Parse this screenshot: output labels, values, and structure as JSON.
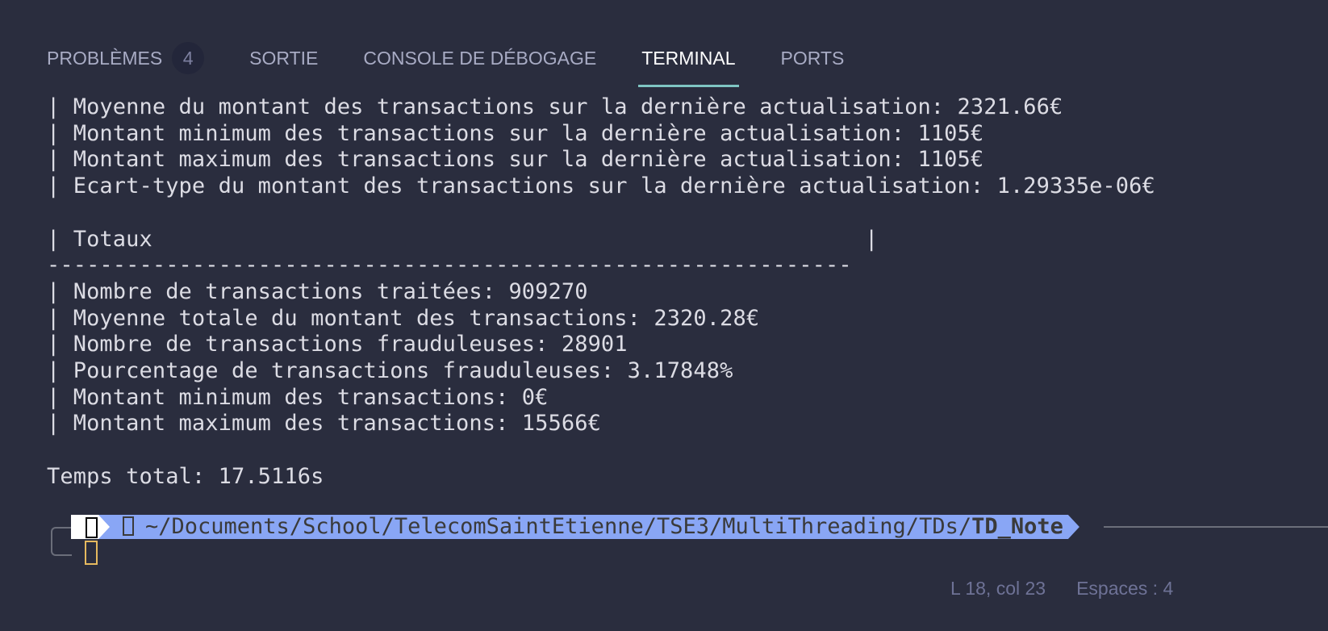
{
  "panel": {
    "tabs": [
      {
        "label": "PROBLÈMES",
        "badge": "4"
      },
      {
        "label": "SORTIE"
      },
      {
        "label": "CONSOLE DE DÉBOGAGE"
      },
      {
        "label": "TERMINAL",
        "active": true
      },
      {
        "label": "PORTS"
      }
    ]
  },
  "terminal": {
    "lines": [
      "| Moyenne du montant des transactions sur la dernière actualisation: 2321.66€",
      "| Montant minimum des transactions sur la dernière actualisation: 1105€",
      "| Montant maximum des transactions sur la dernière actualisation: 1105€",
      "| Ecart-type du montant des transactions sur la dernière actualisation: 1.29335e-06€",
      "",
      "| Totaux                                                      |",
      "-------------------------------------------------------------",
      "| Nombre de transactions traitées: 909270",
      "| Moyenne totale du montant des transactions: 2320.28€",
      "| Nombre de transactions frauduleuses: 28901",
      "| Pourcentage de transactions frauduleuses: 3.17848%",
      "| Montant minimum des transactions: 0€",
      "| Montant maximum des transactions: 15566€",
      "",
      "Temps total: 17.5116s"
    ],
    "prompt": {
      "path": "~/Documents/School/TelecomSaintEtienne/TSE3/MultiThreading/TDs/",
      "current_dir": "TD_Note"
    }
  },
  "status_bar": {
    "position": "L 18, col 23",
    "indent": "Espaces : 4"
  },
  "colors": {
    "background": "#2a2d3e",
    "prompt_path_bg": "#89a6f5",
    "active_tab_underline": "#7fc5c3",
    "cursor": "#e5b95f"
  }
}
